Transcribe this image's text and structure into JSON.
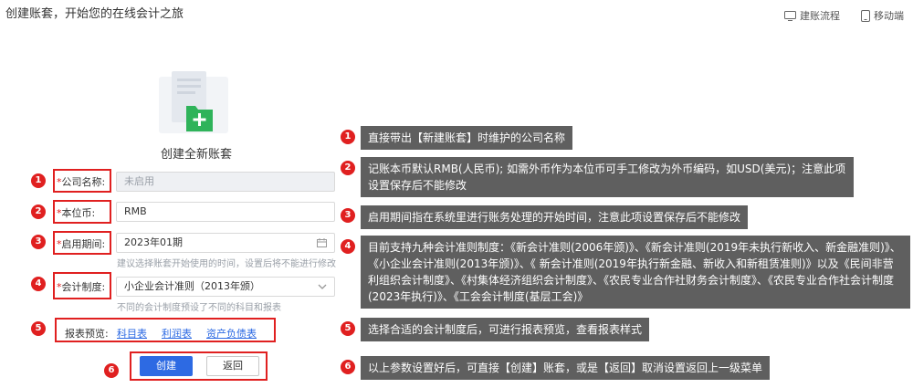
{
  "header": {
    "title": "创建账套，开始您的在线会计之旅",
    "links": [
      {
        "label": "建账流程",
        "icon": "tv-icon"
      },
      {
        "label": "移动端",
        "icon": "mobile-icon"
      }
    ]
  },
  "form": {
    "title": "创建全新账套",
    "fields": {
      "company": {
        "label": "公司名称:",
        "value": "未启用"
      },
      "currency": {
        "label": "本位币:",
        "value": "RMB"
      },
      "period": {
        "label": "启用期间:",
        "value": "2023年01期",
        "hint": "建议选择账套开始使用的时间，设置后将不能进行修改"
      },
      "system": {
        "label": "会计制度:",
        "value": "小企业会计准则（2013年颁）",
        "hint": "不同的会计制度预设了不同的科目和报表"
      }
    },
    "preview": {
      "label": "报表预览:",
      "links": [
        "科目表",
        "利润表",
        "资产负债表"
      ]
    },
    "buttons": {
      "create": "创建",
      "back": "返回"
    }
  },
  "annotations": {
    "badges": [
      "1",
      "2",
      "3",
      "4",
      "5",
      "6"
    ],
    "notes": [
      "直接带出【新建账套】时维护的公司名称",
      "记账本币默认RMB(人民币); 如需外币作为本位币可手工修改为外币编码，如USD(美元)；注意此项设置保存后不能修改",
      "启用期间指在系统里进行账务处理的开始时间，注意此项设置保存后不能修改",
      "目前支持九种会计准则制度：《新会计准则(2006年颁)》、《新会计准则(2019年未执行新收入、新金融准则)》、《小企业会计准则(2013年颁)》、《 新会计准则(2019年执行新金融、新收入和新租赁准则)》以及《民间非营利组织会计制度》、《村集体经济组织会计制度》、《农民专业合作社财务会计制度》、《农民专业合作社会计制度(2023年执行)》、《工会会计制度(基层工会)》",
      "选择合适的会计制度后，可进行报表预览，查看报表样式",
      "以上参数设置好后，可直接【创建】账套，或是【返回】取消设置返回上一级菜单"
    ]
  },
  "colors": {
    "accent": "#2d6ae3",
    "annotation_red": "#e02020",
    "note_bg": "#5f5f5f",
    "folder_green": "#2fb35a"
  }
}
